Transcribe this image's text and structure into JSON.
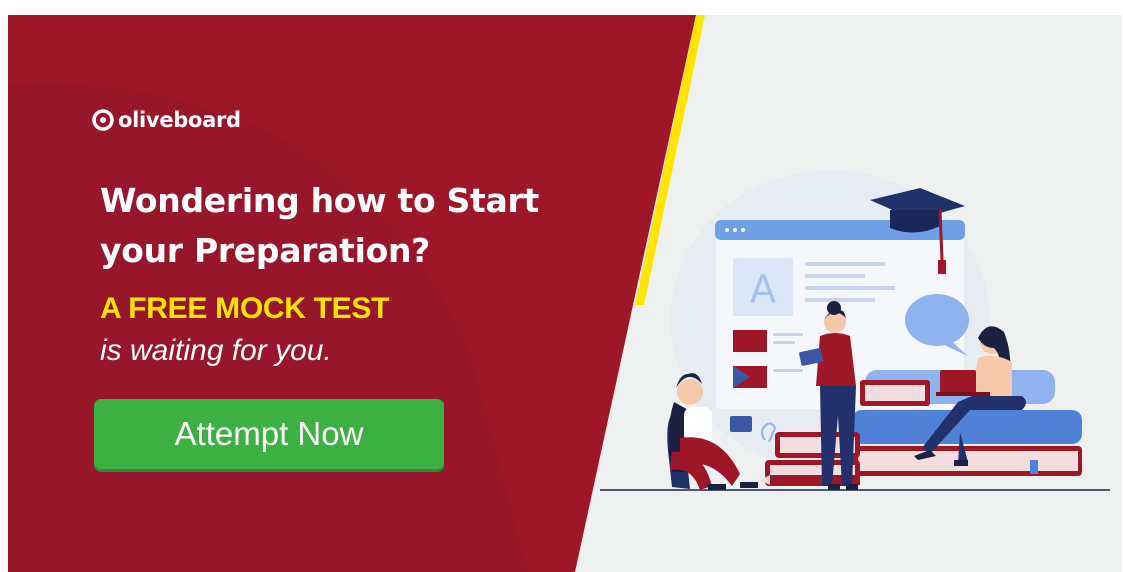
{
  "brand": {
    "name": "oliveboard",
    "logo_icon": "oliveboard-logo-icon"
  },
  "headline": {
    "line1": "Wondering how to Start",
    "line2": "your Preparation?"
  },
  "offer": {
    "highlight": "A FREE MOCK TEST",
    "tagline": "is waiting for you."
  },
  "cta": {
    "label": "Attempt Now"
  },
  "illustration": {
    "browser_letter": "A",
    "icons": [
      "graduation-cap-icon",
      "speech-bubble-icon",
      "paperclip-icon",
      "book-stack-icon",
      "laptop-icon"
    ]
  },
  "colors": {
    "panel_red": "#9e1728",
    "accent_yellow": "#ffe500",
    "cta_green": "#3cb043",
    "background_gray": "#eff1f1"
  }
}
